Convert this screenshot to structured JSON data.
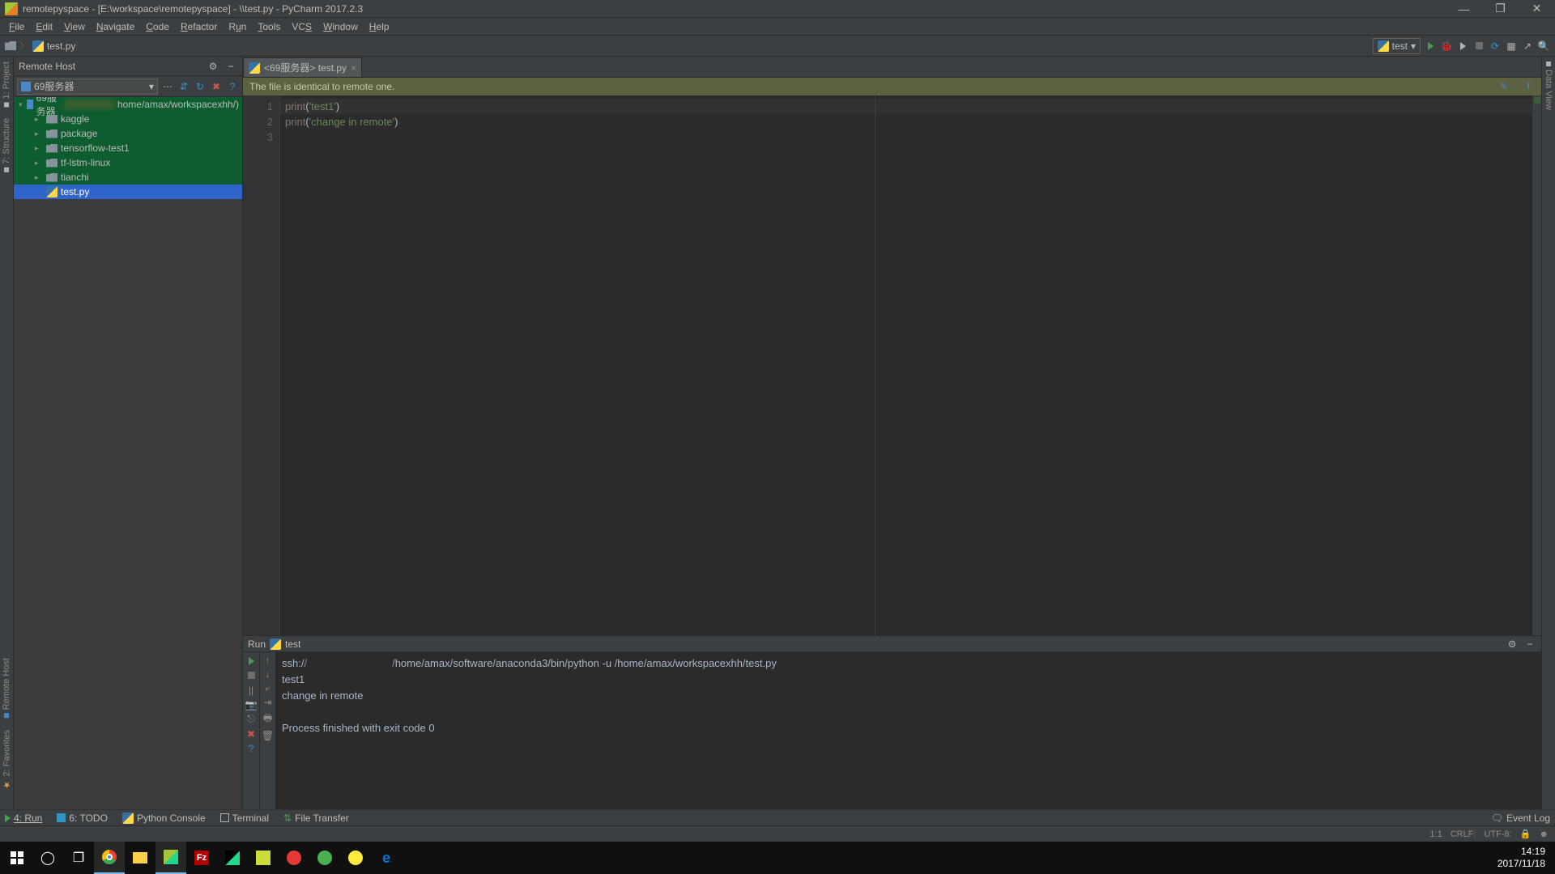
{
  "window": {
    "title": "remotepyspace - [E:\\workspace\\remotepyspace] - \\\\test.py - PyCharm 2017.2.3"
  },
  "menu": {
    "items": [
      "File",
      "Edit",
      "View",
      "Navigate",
      "Code",
      "Refactor",
      "Run",
      "Tools",
      "VCS",
      "Window",
      "Help"
    ]
  },
  "breadcrumb": {
    "file": "test.py"
  },
  "runconfig": {
    "selected": "test"
  },
  "remotehost": {
    "title": "Remote Host",
    "server": "69服务器",
    "rootLabel": "69服务器",
    "rootPath": "home/amax/workspacexhh/)",
    "folders": [
      "kaggle",
      "package",
      "tensorflow-test1",
      "tf-lstm-linux",
      "tianchi"
    ],
    "file": "test.py"
  },
  "editor": {
    "tab": "<69服务器> test.py",
    "notice": "The file is identical to remote one.",
    "lines": {
      "1": {
        "fn": "print",
        "p": "(",
        "s": "'test1'",
        "c": ")"
      },
      "2": {
        "fn": "print",
        "p": "(",
        "s": "'change in remote'",
        "c": ")"
      }
    }
  },
  "run": {
    "label": "Run",
    "name": "test",
    "output": {
      "cmd_pre": "ssh://",
      "cmd_post": "/home/amax/software/anaconda3/bin/python -u /home/amax/workspacexhh/test.py",
      "l2": "test1",
      "l3": "change in remote",
      "l4": "",
      "l5": "Process finished with exit code 0"
    }
  },
  "bottom": {
    "run": "4: Run",
    "todo": "6: TODO",
    "pyconsole": "Python Console",
    "terminal": "Terminal",
    "filetransfer": "File Transfer",
    "eventlog": "Event Log"
  },
  "status": {
    "pos": "1:1",
    "sep": "CRLF:",
    "enc": "UTF-8:"
  },
  "gutter": {
    "project": "1: Project",
    "structure": "7: Structure",
    "remotehost": "Remote Host",
    "favorites": "2: Favorites",
    "dbview": "Data View"
  },
  "taskbar": {
    "time": "14:19",
    "date": "2017/11/18"
  }
}
